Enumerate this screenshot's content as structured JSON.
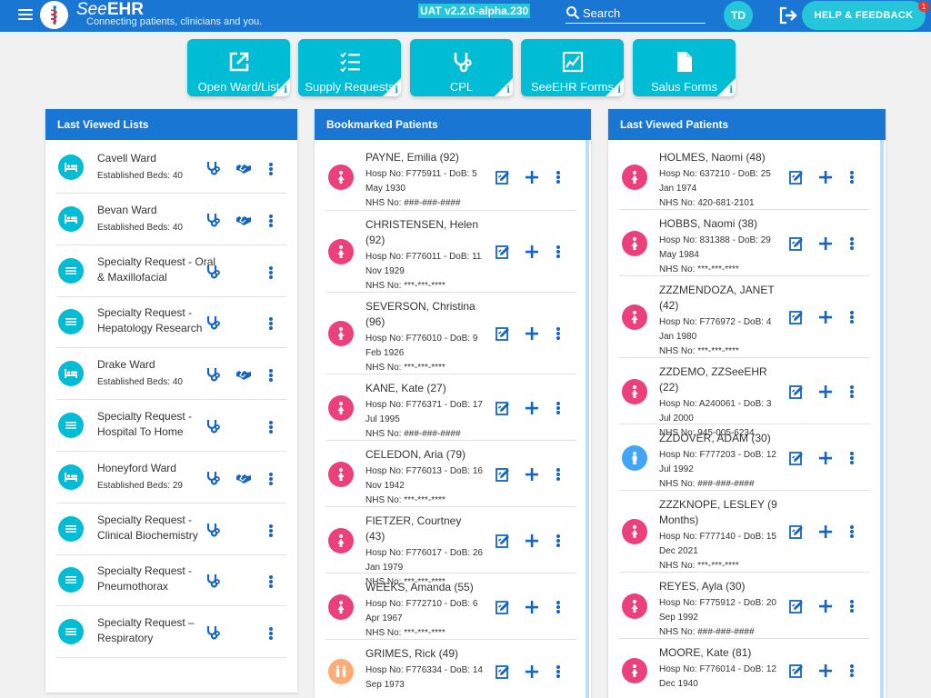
{
  "header": {
    "brand_see": "See",
    "brand_ehr": "EHR",
    "tagline": "Connecting patients, clinicians and you.",
    "version": "UAT v2.2.0-alpha.230",
    "search_placeholder": "Search",
    "user_initials": "TD",
    "help_label": "HELP & FEEDBACK",
    "help_badge": "1",
    "brand_color": "#1976d2",
    "accent_color": "#26c6da"
  },
  "quick_links": [
    {
      "label": "Open Ward/List",
      "icon": "open-external-icon"
    },
    {
      "label": "Supply Requests",
      "icon": "checklist-icon"
    },
    {
      "label": "CPL",
      "icon": "stethoscope-icon"
    },
    {
      "label": "SeeEHR Forms",
      "icon": "form-edit-icon"
    },
    {
      "label": "Salus Forms",
      "icon": "document-icon"
    }
  ],
  "info_glyph": "i",
  "last_viewed_lists": {
    "title": "Last Viewed Lists",
    "items": [
      {
        "type": "ward",
        "title": "Cavell Ward",
        "subtitle": "Established Beds: 40"
      },
      {
        "type": "ward",
        "title": "Bevan Ward",
        "subtitle": "Established Beds: 40"
      },
      {
        "type": "specialty",
        "title": "Specialty Request - Oral & Maxillofacial"
      },
      {
        "type": "specialty",
        "title": "Specialty Request - Hepatology Research"
      },
      {
        "type": "ward",
        "title": "Drake Ward",
        "subtitle": "Established Beds: 40"
      },
      {
        "type": "specialty",
        "title": "Specialty Request - Hospital To Home"
      },
      {
        "type": "ward",
        "title": "Honeyford Ward",
        "subtitle": "Established Beds: 29"
      },
      {
        "type": "specialty",
        "title": "Specialty Request - Clinical Biochemistry"
      },
      {
        "type": "specialty",
        "title": "Specialty Request - Pneumothorax"
      },
      {
        "type": "specialty",
        "title": "Specialty Request – Respiratory"
      }
    ]
  },
  "bookmarked_patients": {
    "title": "Bookmarked Patients",
    "items": [
      {
        "gender": "female",
        "name": "PAYNE, Emilia (92)",
        "hosp": "Hosp No: F775911 - DoB: 5 May 1930",
        "nhs": "NHS No: ###-###-####"
      },
      {
        "gender": "female",
        "name": "CHRISTENSEN, Helen (92)",
        "hosp": "Hosp No: F776011 - DoB: 11 Nov 1929",
        "nhs": "NHS No: ***-***-****"
      },
      {
        "gender": "female",
        "name": "SEVERSON, Christina (96)",
        "hosp": "Hosp No: F776010 - DoB: 9 Feb 1926",
        "nhs": "NHS No: ***-***-****"
      },
      {
        "gender": "female",
        "name": "KANE, Kate (27)",
        "hosp": "Hosp No: F776371 - DoB: 17 Jul 1995",
        "nhs": "NHS No: ###-###-####"
      },
      {
        "gender": "female",
        "name": "CELEDON, Aria (79)",
        "hosp": "Hosp No: F776013 - DoB: 16 Nov 1942",
        "nhs": "NHS No: ***-***-****"
      },
      {
        "gender": "female",
        "name": "FIETZER, Courtney (43)",
        "hosp": "Hosp No: F776017 - DoB: 26 Jan 1979",
        "nhs": "NHS No: ***-***-****"
      },
      {
        "gender": "female",
        "name": "WEEKS, Amanda (55)",
        "hosp": "Hosp No: F772710 - DoB: 6 Apr 1967",
        "nhs": "NHS No: ***-***-****"
      },
      {
        "gender": "unknown",
        "name": "GRIMES, Rick (49)",
        "hosp": "Hosp No: F776334 - DoB: 14 Sep 1973",
        "nhs": ""
      }
    ]
  },
  "last_viewed_patients": {
    "title": "Last Viewed Patients",
    "items": [
      {
        "gender": "female",
        "name": "HOLMES, Naomi (48)",
        "hosp": "Hosp No: 637210 - DoB: 25 Jan 1974",
        "nhs": "NHS No: 420-681-2101"
      },
      {
        "gender": "female",
        "name": "HOBBS, Naomi (38)",
        "hosp": "Hosp No: 831388 - DoB: 29 May 1984",
        "nhs": "NHS No: ***-***-****"
      },
      {
        "gender": "female",
        "name": "ZZZMENDOZA, JANET (42)",
        "hosp": "Hosp No: F776972 - DoB: 4 Jan 1980",
        "nhs": "NHS No: ***-***-****"
      },
      {
        "gender": "female",
        "name": "ZZDEMO, ZZSeeEHR (22)",
        "hosp": "Hosp No: A240061 - DoB: 3 Jul 2000",
        "nhs": "NHS No: 945-005-6234"
      },
      {
        "gender": "male",
        "name": "ZZDOVER, ADAM (30)",
        "hosp": "Hosp No: F777203 - DoB: 12 Jul 1992",
        "nhs": "NHS No: ###-###-####"
      },
      {
        "gender": "female",
        "name": "ZZZKNOPE, LESLEY (9 Months)",
        "hosp": "Hosp No: F777140 - DoB: 15 Dec 2021",
        "nhs": "NHS No: ***-***-****"
      },
      {
        "gender": "female",
        "name": "REYES, Ayla (30)",
        "hosp": "Hosp No: F775912 - DoB: 20 Sep 1992",
        "nhs": "NHS No: ###-###-####"
      },
      {
        "gender": "female",
        "name": "MOORE, Kate (81)",
        "hosp": "Hosp No: F776014 - DoB: 12 Dec 1940",
        "nhs": ""
      }
    ]
  },
  "colors": {
    "female": "#ec407a",
    "male": "#42a5f5",
    "unknown": "#ffab76",
    "list_icon": "#00bcd4",
    "action": "#1565c0"
  }
}
